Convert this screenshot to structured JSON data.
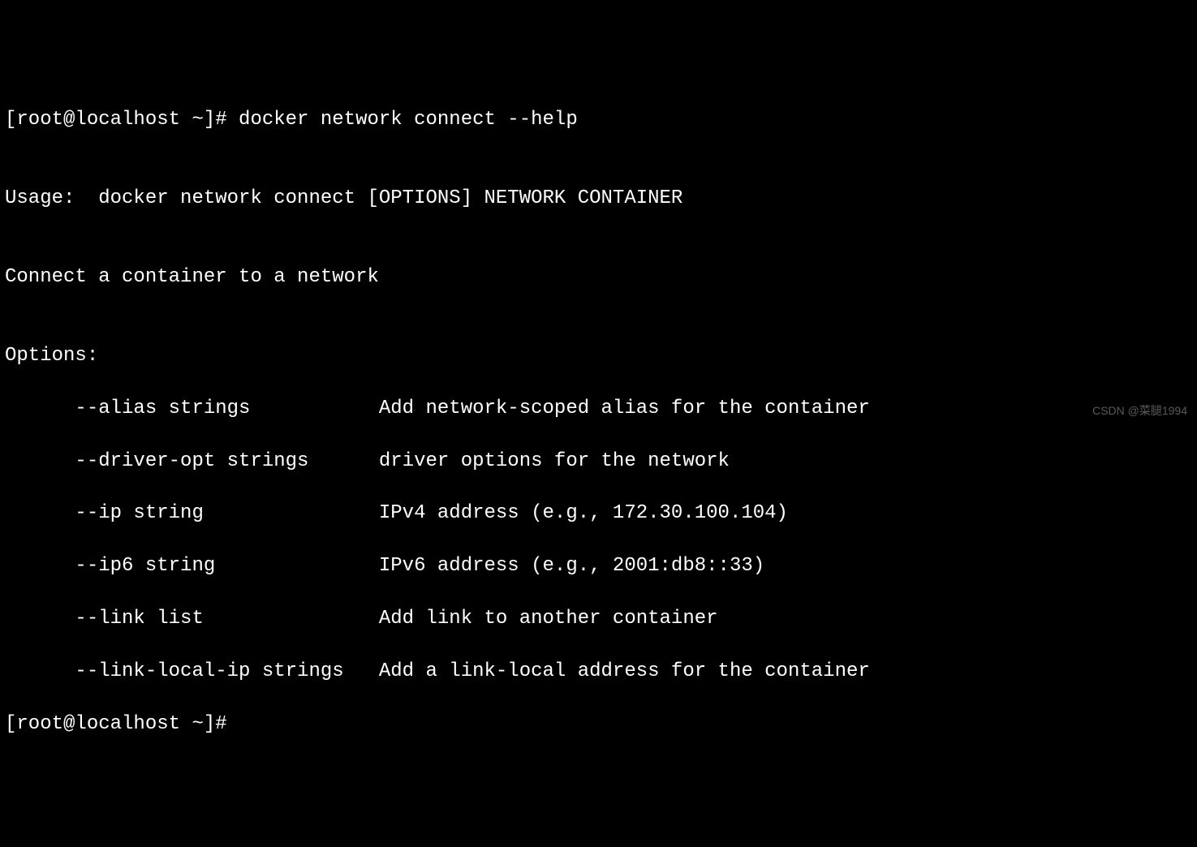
{
  "terminal": {
    "prompt1": "[root@localhost ~]# ",
    "command": "docker network connect --help",
    "blank1": "",
    "usage_line": "Usage:  docker network connect [OPTIONS] NETWORK CONTAINER",
    "blank2": "",
    "description": "Connect a container to a network",
    "blank3": "",
    "options_header": "Options:",
    "options": [
      {
        "flag": "      --alias strings           ",
        "desc": "Add network-scoped alias for the container"
      },
      {
        "flag": "      --driver-opt strings      ",
        "desc": "driver options for the network"
      },
      {
        "flag": "      --ip string               ",
        "desc": "IPv4 address (e.g., 172.30.100.104)"
      },
      {
        "flag": "      --ip6 string              ",
        "desc": "IPv6 address (e.g., 2001:db8::33)"
      },
      {
        "flag": "      --link list               ",
        "desc": "Add link to another container"
      },
      {
        "flag": "      --link-local-ip strings   ",
        "desc": "Add a link-local address for the container"
      }
    ],
    "prompt2": "[root@localhost ~]# "
  },
  "watermark": "CSDN @菜腿1994"
}
